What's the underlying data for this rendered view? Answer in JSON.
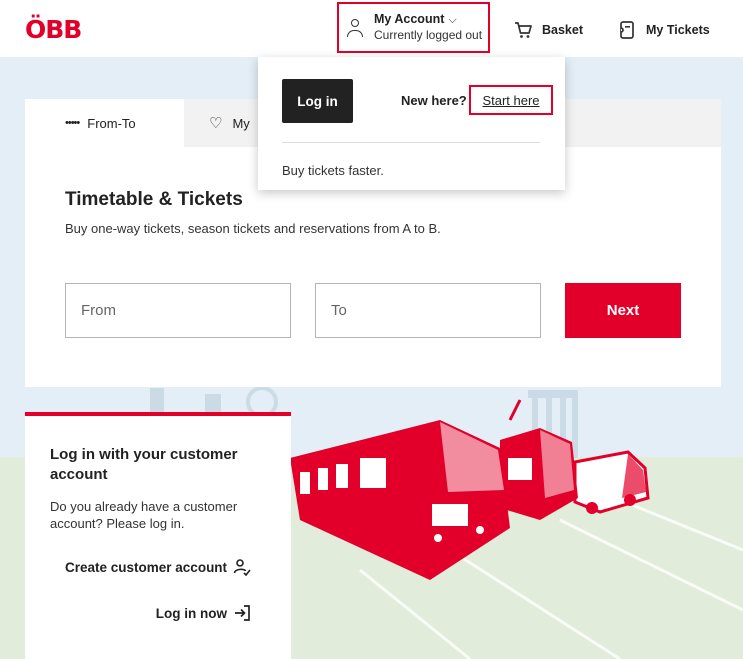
{
  "header": {
    "logo": "ÖBB",
    "account_title": "My Account",
    "account_chevron": "⌵",
    "account_status": "Currently logged out",
    "basket": "Basket",
    "my_tickets": "My Tickets"
  },
  "dropdown": {
    "login_button": "Log in",
    "new_here": "New here?",
    "start_here": "Start here",
    "tagline": "Buy tickets faster."
  },
  "tabs": {
    "from_to": "From-To",
    "my_prefix": "My"
  },
  "main": {
    "title": "Timetable & Tickets",
    "subtitle": "Buy one-way tickets, season tickets and reservations from A to B.",
    "from_placeholder": "From",
    "to_placeholder": "To",
    "next_button": "Next"
  },
  "login_card": {
    "title": "Log in with your customer account",
    "text": "Do you already have a customer account? Please log in.",
    "create_account": "Create customer account",
    "login_now": "Log in now"
  },
  "colors": {
    "brand_red": "#e2002a",
    "dark_button": "#222222",
    "sky": "#e3eef6",
    "ground": "#e1ecdb"
  },
  "icons": [
    "person-icon",
    "basket-icon",
    "ticket-icon",
    "heart-icon",
    "add-user-icon",
    "login-arrow-icon"
  ]
}
